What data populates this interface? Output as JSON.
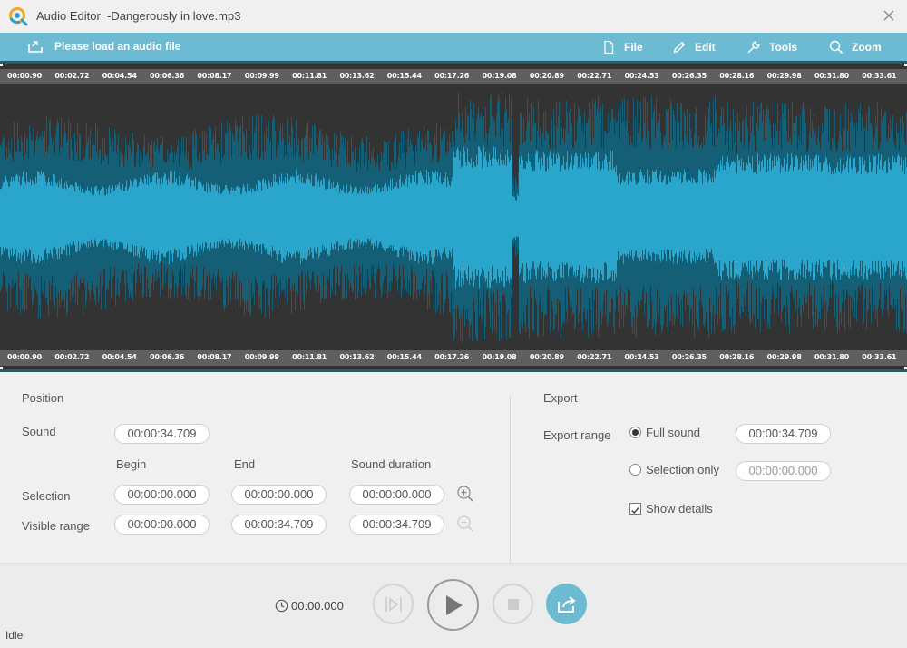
{
  "window": {
    "app_name": "Audio Editor",
    "file_title": "-Dangerously in love.mp3"
  },
  "toolbar": {
    "load_label": "Please load an audio file",
    "menu": [
      {
        "label": "File",
        "icon": "file-icon"
      },
      {
        "label": "Edit",
        "icon": "pencil-icon"
      },
      {
        "label": "Tools",
        "icon": "wrench-icon"
      },
      {
        "label": "Zoom",
        "icon": "magnifier-icon"
      }
    ]
  },
  "timeline": {
    "ticks": [
      "00:00.90",
      "00:02.72",
      "00:04.54",
      "00:06.36",
      "00:08.17",
      "00:09.99",
      "00:11.81",
      "00:13.62",
      "00:15.44",
      "00:17.26",
      "00:19.08",
      "00:20.89",
      "00:22.71",
      "00:24.53",
      "00:26.35",
      "00:28.16",
      "00:29.98",
      "00:31.80",
      "00:33.61"
    ],
    "colors": {
      "wave_light": "#2aa6cc",
      "wave_dark": "#145f76",
      "background": "#333333"
    }
  },
  "position": {
    "title": "Position",
    "sound_label": "Sound",
    "sound_value": "00:00:34.709",
    "col_begin": "Begin",
    "col_end": "End",
    "col_duration": "Sound duration",
    "selection_label": "Selection",
    "selection": {
      "begin": "00:00:00.000",
      "end": "00:00:00.000",
      "duration": "00:00:00.000"
    },
    "visible_label": "Visible range",
    "visible": {
      "begin": "00:00:00.000",
      "end": "00:00:34.709",
      "duration": "00:00:34.709"
    }
  },
  "export": {
    "title": "Export",
    "range_label": "Export range",
    "full_sound_label": "Full sound",
    "full_sound_value": "00:00:34.709",
    "selection_only_label": "Selection only",
    "selection_only_value": "00:00:00.000",
    "show_details_label": "Show details",
    "full_sound_checked": true,
    "show_details_checked": true
  },
  "player": {
    "time": "00:00.000",
    "accent": "#6dbad3"
  },
  "status": "Idle"
}
